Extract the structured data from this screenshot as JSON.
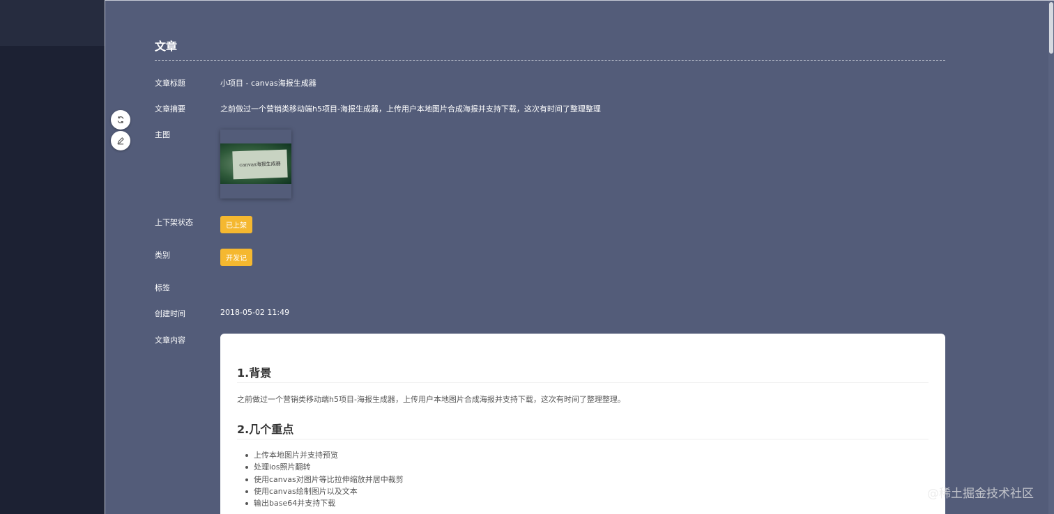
{
  "page": {
    "title": "文章"
  },
  "fields": {
    "article_title_label": "文章标题",
    "article_title_value": "小项目 - canvas海报生成器",
    "summary_label": "文章摘要",
    "summary_value": "之前做过一个营销类移动端h5项目-海报生成器，上传用户本地图片合成海报并支持下载，这次有时间了整理整理",
    "main_image_label": "主图",
    "main_image_text": "canvas海报生成器",
    "status_label": "上下架状态",
    "status_value": "已上架",
    "category_label": "类别",
    "category_value": "开发记",
    "tags_label": "标签",
    "created_label": "创建时间",
    "created_value": "2018-05-02 11:49",
    "content_label": "文章内容"
  },
  "content": {
    "h1": "1.背景",
    "p1": "之前做过一个营销类移动端h5项目-海报生成器，上传用户本地图片合成海报并支持下载，这次有时间了整理整理。",
    "h2": "2.几个重点",
    "list": [
      "上传本地图片并支持预览",
      "处理ios照片翻转",
      "使用canvas对图片等比拉伸缩放并居中裁剪",
      "使用canvas绘制图片以及文本",
      "输出base64并支持下载"
    ]
  },
  "actions": {
    "refresh_icon": "refresh-icon",
    "edit_icon": "edit-icon"
  },
  "colors": {
    "panel_bg": "#535c79",
    "accent": "#f5b830",
    "sidebar_bg": "#1c2133"
  },
  "watermark": "@稀土掘金技术社区"
}
